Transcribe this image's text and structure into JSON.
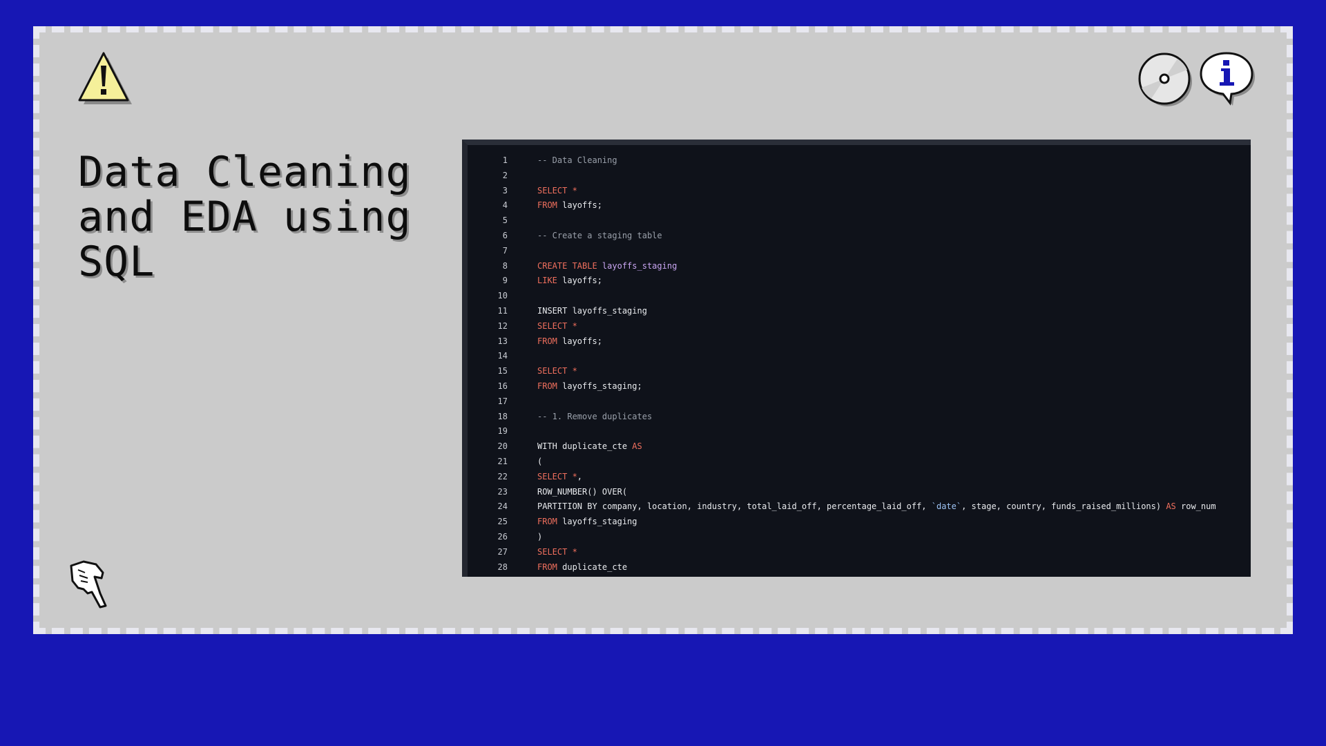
{
  "title": "Data Cleaning and EDA using SQL",
  "icons": [
    "warning-icon",
    "disc-icon",
    "info-icon",
    "pointing-hand-icon"
  ],
  "colors": {
    "background": "#1717b4",
    "panel": "#cbcbcb",
    "editor_bg": "#0f121a",
    "keyword": "#ef6f5d",
    "comment": "#9aa0aa",
    "table_name": "#c9a6f2"
  },
  "code_lines": [
    {
      "n": "1",
      "segs": [
        {
          "t": "-- Data Cleaning",
          "c": "cm"
        }
      ]
    },
    {
      "n": "2",
      "segs": []
    },
    {
      "n": "3",
      "segs": [
        {
          "t": "SELECT *",
          "c": "kw"
        }
      ]
    },
    {
      "n": "4",
      "segs": [
        {
          "t": "FROM",
          "c": "kw"
        },
        {
          "t": " layoffs;",
          "c": ""
        }
      ]
    },
    {
      "n": "5",
      "segs": []
    },
    {
      "n": "6",
      "segs": [
        {
          "t": "-- Create a staging table",
          "c": "cm"
        }
      ]
    },
    {
      "n": "7",
      "segs": []
    },
    {
      "n": "8",
      "segs": [
        {
          "t": "CREATE TABLE",
          "c": "kw"
        },
        {
          "t": " layoffs_staging",
          "c": "tb"
        }
      ]
    },
    {
      "n": "9",
      "segs": [
        {
          "t": "LIKE",
          "c": "kw"
        },
        {
          "t": " layoffs;",
          "c": ""
        }
      ]
    },
    {
      "n": "10",
      "segs": []
    },
    {
      "n": "11",
      "segs": [
        {
          "t": "INSERT layoffs_staging",
          "c": ""
        }
      ]
    },
    {
      "n": "12",
      "segs": [
        {
          "t": "SELECT *",
          "c": "kw"
        }
      ]
    },
    {
      "n": "13",
      "segs": [
        {
          "t": "FROM",
          "c": "kw"
        },
        {
          "t": " layoffs;",
          "c": ""
        }
      ]
    },
    {
      "n": "14",
      "segs": []
    },
    {
      "n": "15",
      "segs": [
        {
          "t": "SELECT *",
          "c": "kw"
        }
      ]
    },
    {
      "n": "16",
      "segs": [
        {
          "t": "FROM",
          "c": "kw"
        },
        {
          "t": " layoffs_staging;",
          "c": ""
        }
      ]
    },
    {
      "n": "17",
      "segs": []
    },
    {
      "n": "18",
      "segs": [
        {
          "t": "-- 1. Remove duplicates",
          "c": "cm"
        }
      ]
    },
    {
      "n": "19",
      "segs": []
    },
    {
      "n": "20",
      "segs": [
        {
          "t": "WITH duplicate_cte ",
          "c": ""
        },
        {
          "t": "AS",
          "c": "kw"
        }
      ]
    },
    {
      "n": "21",
      "segs": [
        {
          "t": "(",
          "c": ""
        }
      ]
    },
    {
      "n": "22",
      "segs": [
        {
          "t": "SELECT *",
          "c": "kw"
        },
        {
          "t": ",",
          "c": ""
        }
      ]
    },
    {
      "n": "23",
      "segs": [
        {
          "t": "ROW_NUMBER() OVER(",
          "c": ""
        }
      ]
    },
    {
      "n": "24",
      "segs": [
        {
          "t": "PARTITION BY company, location, industry, total_laid_off, percentage_laid_off, ",
          "c": ""
        },
        {
          "t": "`date`",
          "c": "bt"
        },
        {
          "t": ", stage, country, funds_raised_millions) ",
          "c": ""
        },
        {
          "t": "AS",
          "c": "kw"
        },
        {
          "t": " row_num",
          "c": ""
        }
      ]
    },
    {
      "n": "25",
      "segs": [
        {
          "t": "FROM",
          "c": "kw"
        },
        {
          "t": " layoffs_staging",
          "c": ""
        }
      ]
    },
    {
      "n": "26",
      "segs": [
        {
          "t": ")",
          "c": ""
        }
      ]
    },
    {
      "n": "27",
      "segs": [
        {
          "t": "SELECT *",
          "c": "kw"
        }
      ]
    },
    {
      "n": "28",
      "segs": [
        {
          "t": "FROM",
          "c": "kw"
        },
        {
          "t": " duplicate_cte",
          "c": ""
        }
      ]
    }
  ]
}
